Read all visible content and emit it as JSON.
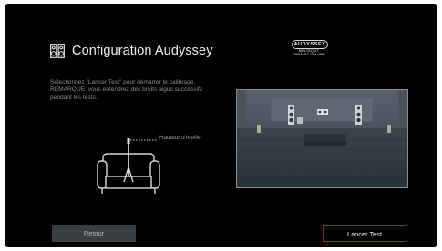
{
  "screen": {
    "title": "Configuration Audyssey",
    "title_icon": "speaker-pair-icon",
    "logo": {
      "brand": "AUDYSSEY",
      "line1": "MULTEQ XT",
      "line2": "DYNAMIC VOLUME"
    },
    "description": [
      "Sélectionnez \"Lancer Test\" pour démarrer le calibrage.",
      "REMARQUE: vous entendrez des bruits aigus successifs",
      "pendant les tests."
    ],
    "ear_height_label": "Hauteur d'oreille",
    "buttons": {
      "back": "Retour",
      "start": "Lancer Test"
    },
    "colors": {
      "background": "#000000",
      "back_button": "#3a3e43",
      "start_border": "#e0001a",
      "text": "#f0f0f0",
      "muted_text": "#8c8c8c"
    }
  }
}
